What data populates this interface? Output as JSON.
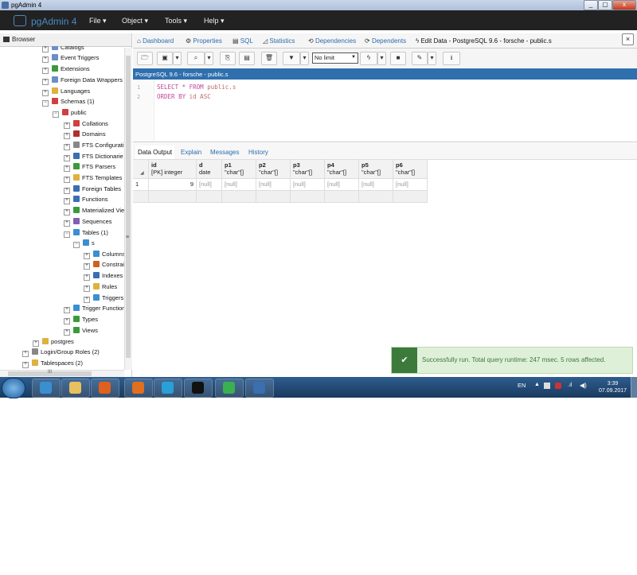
{
  "window": {
    "title": "pgAdmin 4",
    "min": "_",
    "max": "▢",
    "close": "x"
  },
  "menubar": {
    "brand": "pgAdmin 4",
    "items": [
      {
        "label": "File ▾"
      },
      {
        "label": "Object ▾"
      },
      {
        "label": "Tools ▾"
      },
      {
        "label": "Help ▾"
      }
    ]
  },
  "browser": {
    "title": "Browser",
    "nodes": [
      {
        "label": "Catalogs",
        "icon": "catalog-icon",
        "color": "#6a8fc7"
      },
      {
        "label": "Event Triggers",
        "icon": "event-trigger-icon",
        "color": "#6a8fc7"
      },
      {
        "label": "Extensions",
        "icon": "extension-icon",
        "color": "#3c9a3c"
      },
      {
        "label": "Foreign Data Wrappers",
        "icon": "fdw-icon",
        "color": "#6a8fc7"
      },
      {
        "label": "Languages",
        "icon": "language-icon",
        "color": "#e0b040"
      },
      {
        "label": "Schemas (1)",
        "icon": "schemas-icon",
        "color": "#d04040"
      },
      {
        "label": "public",
        "icon": "schema-icon",
        "color": "#d04040"
      },
      {
        "label": "Collations",
        "icon": "collation-icon",
        "color": "#d04040"
      },
      {
        "label": "Domains",
        "icon": "domain-icon",
        "color": "#b03030"
      },
      {
        "label": "FTS Configurati",
        "icon": "fts-config-icon",
        "color": "#888888"
      },
      {
        "label": "FTS Dictionarie",
        "icon": "fts-dict-icon",
        "color": "#3a6fb0"
      },
      {
        "label": "FTS Parsers",
        "icon": "fts-parser-icon",
        "color": "#3c9a3c"
      },
      {
        "label": "FTS Templates",
        "icon": "fts-template-icon",
        "color": "#e0b040"
      },
      {
        "label": "Foreign Tables",
        "icon": "foreign-table-icon",
        "color": "#3a6fb0"
      },
      {
        "label": "Functions",
        "icon": "function-icon",
        "color": "#3a6fb0"
      },
      {
        "label": "Materialized Vie",
        "icon": "mview-icon",
        "color": "#3c9a3c"
      },
      {
        "label": "Sequences",
        "icon": "sequence-icon",
        "color": "#8060b0"
      },
      {
        "label": "Tables (1)",
        "icon": "tables-icon",
        "color": "#3a8fd0"
      },
      {
        "label": "s",
        "icon": "table-icon",
        "color": "#3a8fd0"
      },
      {
        "label": "Columns",
        "icon": "columns-icon",
        "color": "#3a8fd0"
      },
      {
        "label": "Constrai",
        "icon": "constraints-icon",
        "color": "#d06020"
      },
      {
        "label": "Indexes",
        "icon": "indexes-icon",
        "color": "#3a6fb0"
      },
      {
        "label": "Rules",
        "icon": "rules-icon",
        "color": "#e0b040"
      },
      {
        "label": "Triggers",
        "icon": "triggers-icon",
        "color": "#3a8fd0"
      },
      {
        "label": "Trigger Function",
        "icon": "trigger-function-icon",
        "color": "#3a8fd0"
      },
      {
        "label": "Types",
        "icon": "types-icon",
        "color": "#3c9a3c"
      },
      {
        "label": "Views",
        "icon": "views-icon",
        "color": "#3c9a3c"
      },
      {
        "label": "postgres",
        "icon": "database-icon",
        "color": "#e0b040"
      },
      {
        "label": "Login/Group Roles (2)",
        "icon": "roles-icon",
        "color": "#888888"
      },
      {
        "label": "Tablespaces (2)",
        "icon": "tablespace-icon",
        "color": "#e0b040"
      }
    ],
    "scroll_mid": "≡",
    "hscroll_mid": "III"
  },
  "tabs": [
    {
      "label": "Dashboard",
      "icon": "dashboard-icon"
    },
    {
      "label": "Properties",
      "icon": "properties-icon"
    },
    {
      "label": "SQL",
      "icon": "sql-icon"
    },
    {
      "label": "Statistics",
      "icon": "statistics-icon"
    },
    {
      "label": "Dependencies",
      "icon": "dependencies-icon"
    },
    {
      "label": "Dependents",
      "icon": "dependents-icon"
    },
    {
      "label": "Edit Data - PostgreSQL 9.6 - forsche - public.s",
      "icon": "lightning-icon"
    }
  ],
  "tab_close": "×",
  "toolbar": {
    "limit": "No limit"
  },
  "connection": "PostgreSQL 9.6 - forsche - public.s",
  "editor": {
    "lines": [
      {
        "no": "1",
        "kw1": "SELECT * FROM",
        "rest": " public.s"
      },
      {
        "no": "2",
        "kw1": "ORDER BY",
        "rest": " id ASC"
      }
    ]
  },
  "output_tabs": [
    "Data Output",
    "Explain",
    "Messages",
    "History"
  ],
  "grid": {
    "columns": [
      {
        "name": "id",
        "type": "[PK] integer"
      },
      {
        "name": "d",
        "type": "date"
      },
      {
        "name": "p1",
        "type": "\"char\"[]"
      },
      {
        "name": "p2",
        "type": "\"char\"[]"
      },
      {
        "name": "p3",
        "type": "\"char\"[]"
      },
      {
        "name": "p4",
        "type": "\"char\"[]"
      },
      {
        "name": "p5",
        "type": "\"char\"[]"
      },
      {
        "name": "p6",
        "type": "\"char\"[]"
      }
    ],
    "rows": [
      {
        "num": "1",
        "cells": [
          "9",
          "[null]",
          "[null]",
          "[null]",
          "[null]",
          "[null]",
          "[null]",
          "[null]"
        ]
      }
    ]
  },
  "toast": {
    "icon": "✔",
    "message": "Successfully run. Total query runtime: 247 msec. 5 rows affected."
  },
  "taskbar": {
    "lang": "EN",
    "time": "3:39",
    "date": "07.09.2017",
    "apps": [
      {
        "name": "ie",
        "color": "#3a8fd0"
      },
      {
        "name": "explorer",
        "color": "#e8c060"
      },
      {
        "name": "media",
        "color": "#e06020"
      },
      {
        "name": "firefox",
        "color": "#e07020"
      },
      {
        "name": "telegram",
        "color": "#2a9fd8"
      },
      {
        "name": "terminal",
        "color": "#111111"
      },
      {
        "name": "pycharm",
        "color": "#3ab050"
      },
      {
        "name": "pgadmin",
        "color": "#3a6fb0"
      }
    ]
  }
}
